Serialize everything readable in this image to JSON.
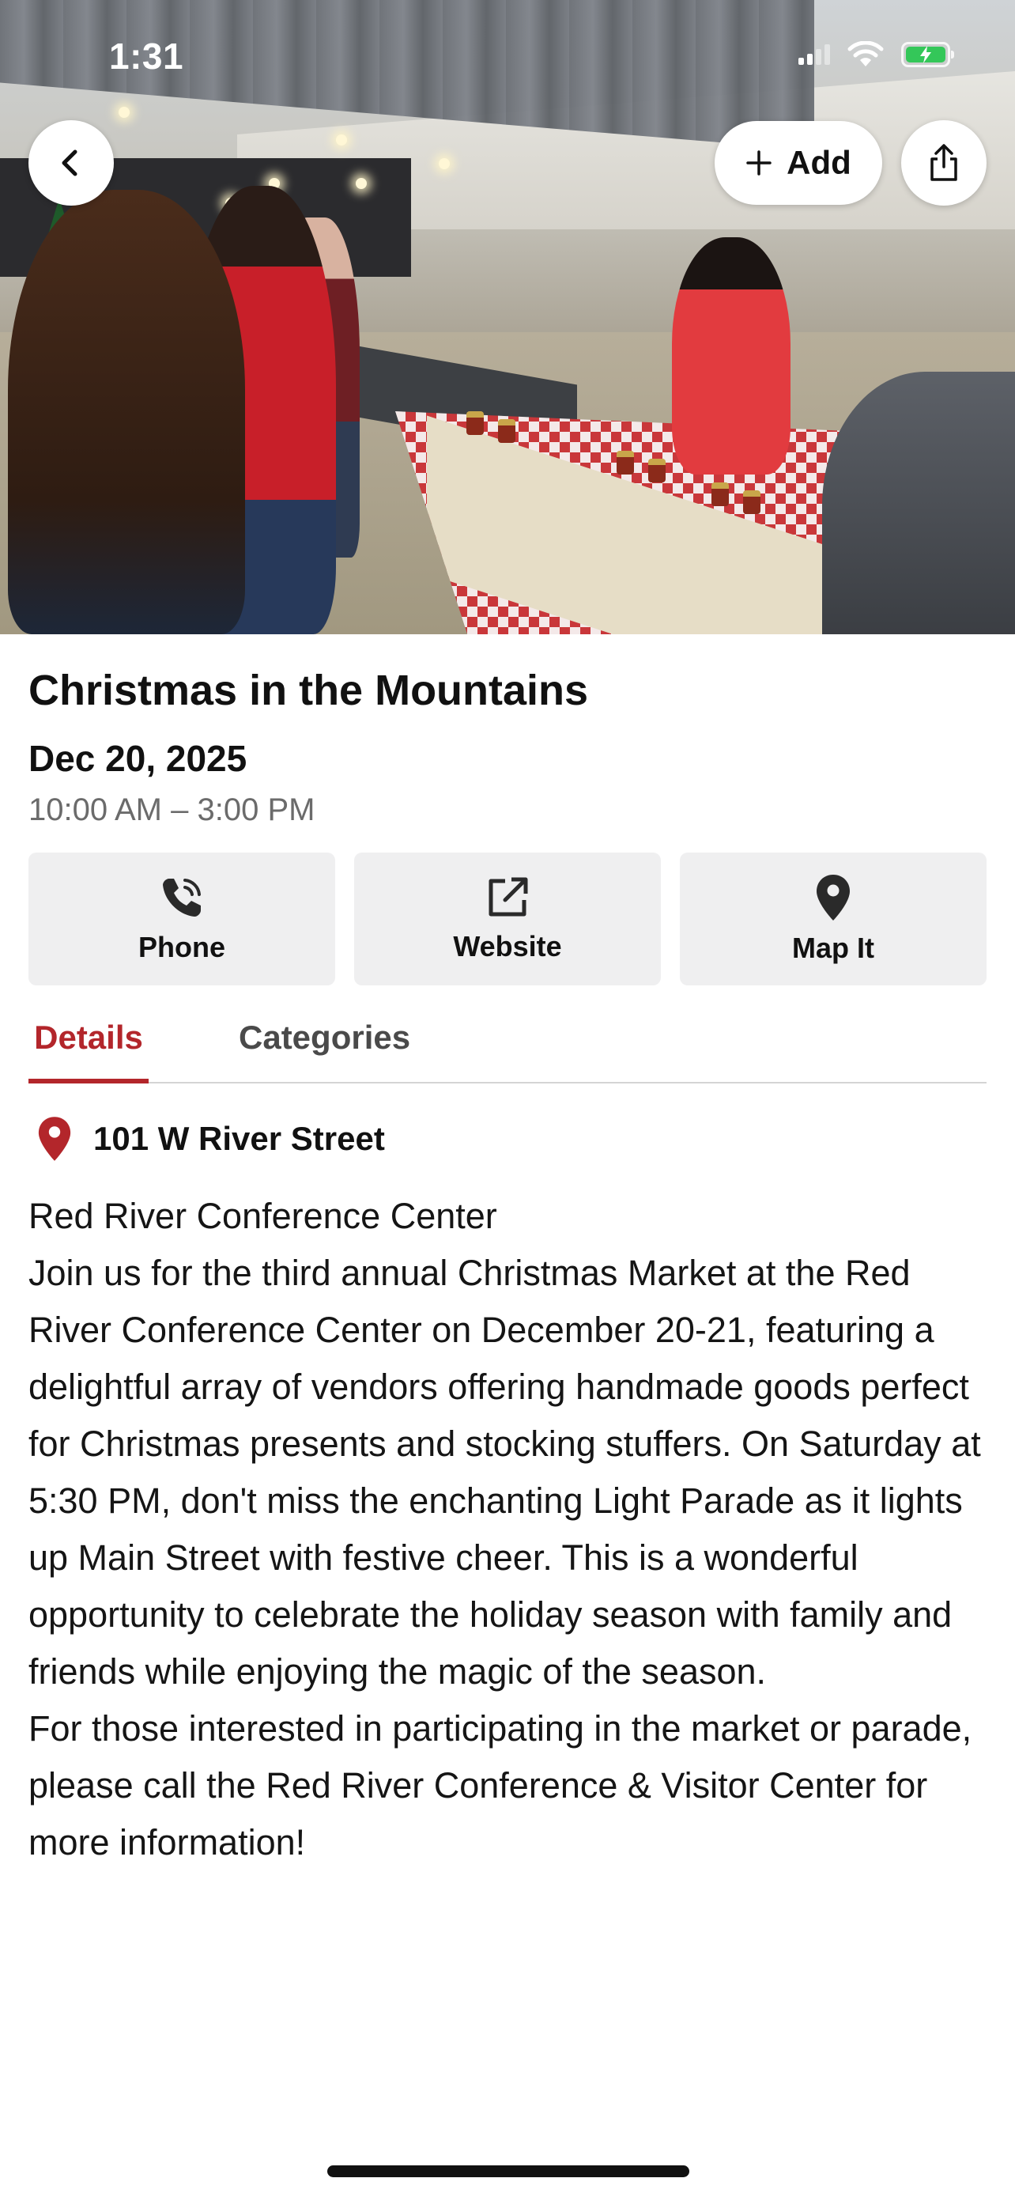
{
  "status_bar": {
    "time": "1:31"
  },
  "header": {
    "add_label": "Add"
  },
  "event": {
    "title": "Christmas in the Mountains",
    "date": "Dec 20, 2025",
    "time_range": "10:00 AM – 3:00 PM"
  },
  "actions": {
    "phone": "Phone",
    "website": "Website",
    "map": "Map It"
  },
  "tabs": {
    "details": "Details",
    "categories": "Categories",
    "active": "Details"
  },
  "details": {
    "address": "101 W River Street",
    "venue": "Red River Conference Center",
    "paragraph_1": "Join us for the third annual Christmas Market at the Red River Conference Center on December 20-21, featuring a delightful array of vendors offering handmade goods perfect for Christmas presents and stocking stuffers. On Saturday at 5:30 PM, don't miss the enchanting Light Parade as it lights up Main Street with festive cheer. This is a wonderful opportunity to celebrate the holiday season with family and friends while enjoying the magic of the season.",
    "paragraph_2": "For those interested in participating in the market or parade, please call the Red River Conference & Visitor Center for more information!"
  },
  "colors": {
    "accent": "#b3262b",
    "action_bg": "#efeff0",
    "secondary_text": "#6b6b6b",
    "battery": "#34c759"
  },
  "icons": {
    "back": "chevron-left-icon",
    "add": "plus-icon",
    "share": "share-icon",
    "phone": "phone-icon",
    "website": "external-link-icon",
    "map": "map-pin-icon",
    "address": "location-pin-icon"
  }
}
